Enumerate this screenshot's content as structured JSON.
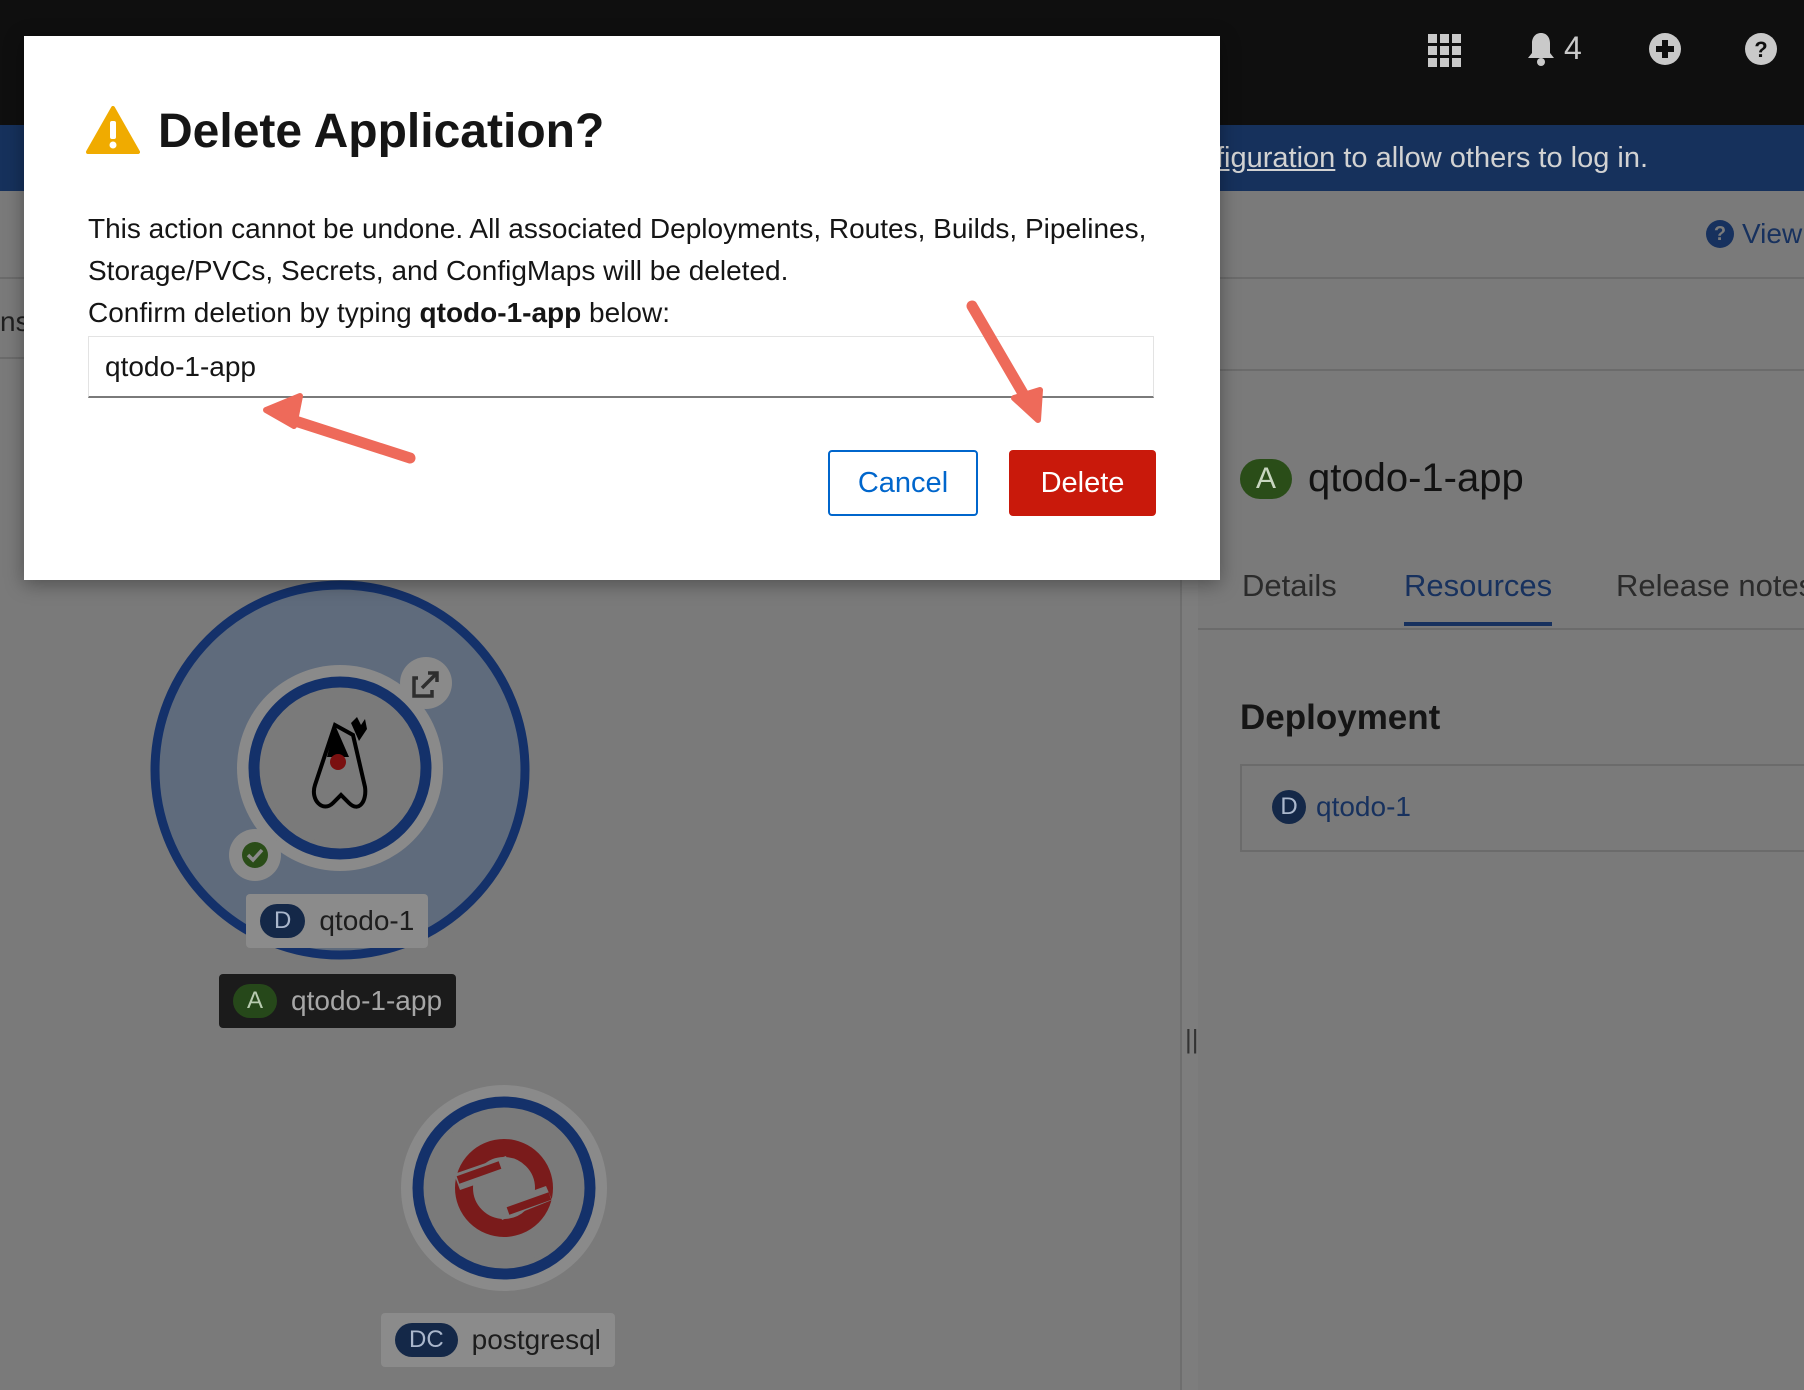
{
  "masthead": {
    "notification_count": "4",
    "icons": [
      "grid-icon",
      "bell-icon",
      "plus-circle-icon",
      "help-icon"
    ]
  },
  "banner": {
    "link_text": "figuration",
    "text": " to allow others to log in."
  },
  "left_panel": {
    "partial_tab": "ns"
  },
  "right_panel": {
    "view_link": "View",
    "app_badge": "A",
    "app_name": "qtodo-1-app",
    "tabs": [
      "Details",
      "Resources",
      "Release notes"
    ],
    "active_tab": "Resources",
    "section_title": "Deployment",
    "resource": {
      "badge": "D",
      "name": "qtodo-1"
    }
  },
  "topology": {
    "nodes": [
      {
        "badge": "D",
        "name": "qtodo-1",
        "icon": "java-duke-icon",
        "status": "check-icon"
      },
      {
        "badge": "DC",
        "name": "postgresql",
        "icon": "openshift-icon"
      }
    ],
    "group": {
      "badge": "A",
      "name": "qtodo-1-app"
    }
  },
  "modal": {
    "title": "Delete Application?",
    "body_line1": "This action cannot be undone. All associated Deployments, Routes, Builds, Pipelines, Storage/PVCs, Secrets, and ConfigMaps will be deleted.",
    "confirm_prefix": "Confirm deletion by typing ",
    "confirm_name": "qtodo-1-app",
    "confirm_suffix": " below:",
    "input_value": "qtodo-1-app",
    "cancel_label": "Cancel",
    "delete_label": "Delete"
  },
  "colors": {
    "danger": "#c9190b",
    "primary": "#0066cc",
    "warning": "#f0ab00",
    "annotation_arrow": "#ee6a5a"
  }
}
